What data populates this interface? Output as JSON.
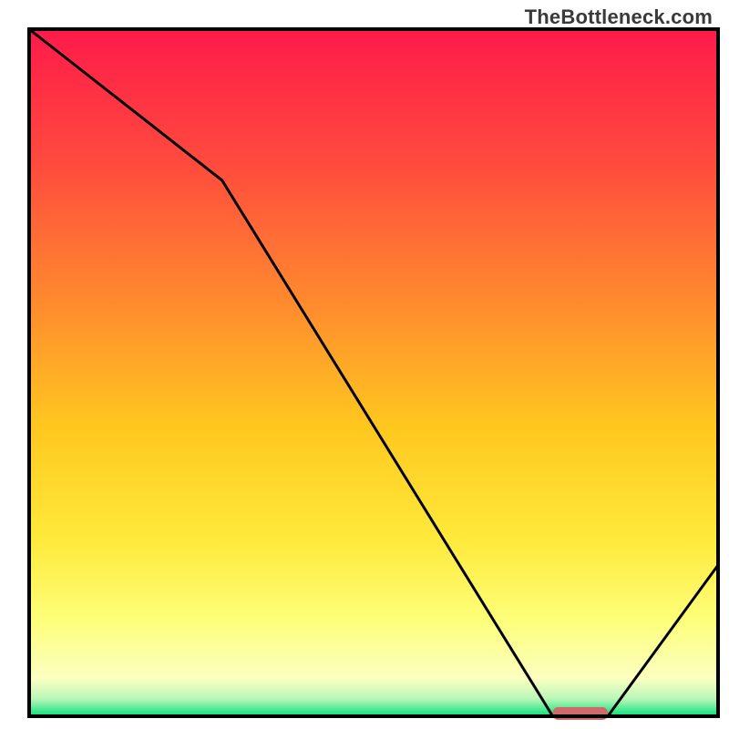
{
  "watermark": "TheBottleneck.com",
  "chart_data": {
    "type": "line",
    "title": "",
    "xlabel": "",
    "ylabel": "",
    "xlim": [
      0,
      100
    ],
    "ylim": [
      0,
      100
    ],
    "x": [
      0,
      28,
      76,
      84,
      100
    ],
    "values": [
      100,
      78,
      0,
      0,
      22
    ],
    "optimum_zone": {
      "x_start": 76,
      "x_end": 84,
      "y": 0
    },
    "background_gradient_stops": [
      {
        "offset": 0.0,
        "color": "#ff1a4b"
      },
      {
        "offset": 0.2,
        "color": "#ff4c3d"
      },
      {
        "offset": 0.4,
        "color": "#ff8b2e"
      },
      {
        "offset": 0.58,
        "color": "#ffc81f"
      },
      {
        "offset": 0.74,
        "color": "#ffe93a"
      },
      {
        "offset": 0.86,
        "color": "#fdff7a"
      },
      {
        "offset": 0.945,
        "color": "#fcffc0"
      },
      {
        "offset": 0.975,
        "color": "#b8f7b8"
      },
      {
        "offset": 1.0,
        "color": "#06e07a"
      }
    ],
    "series_color": "#000000",
    "optimum_marker_color": "#cf6a6a"
  }
}
